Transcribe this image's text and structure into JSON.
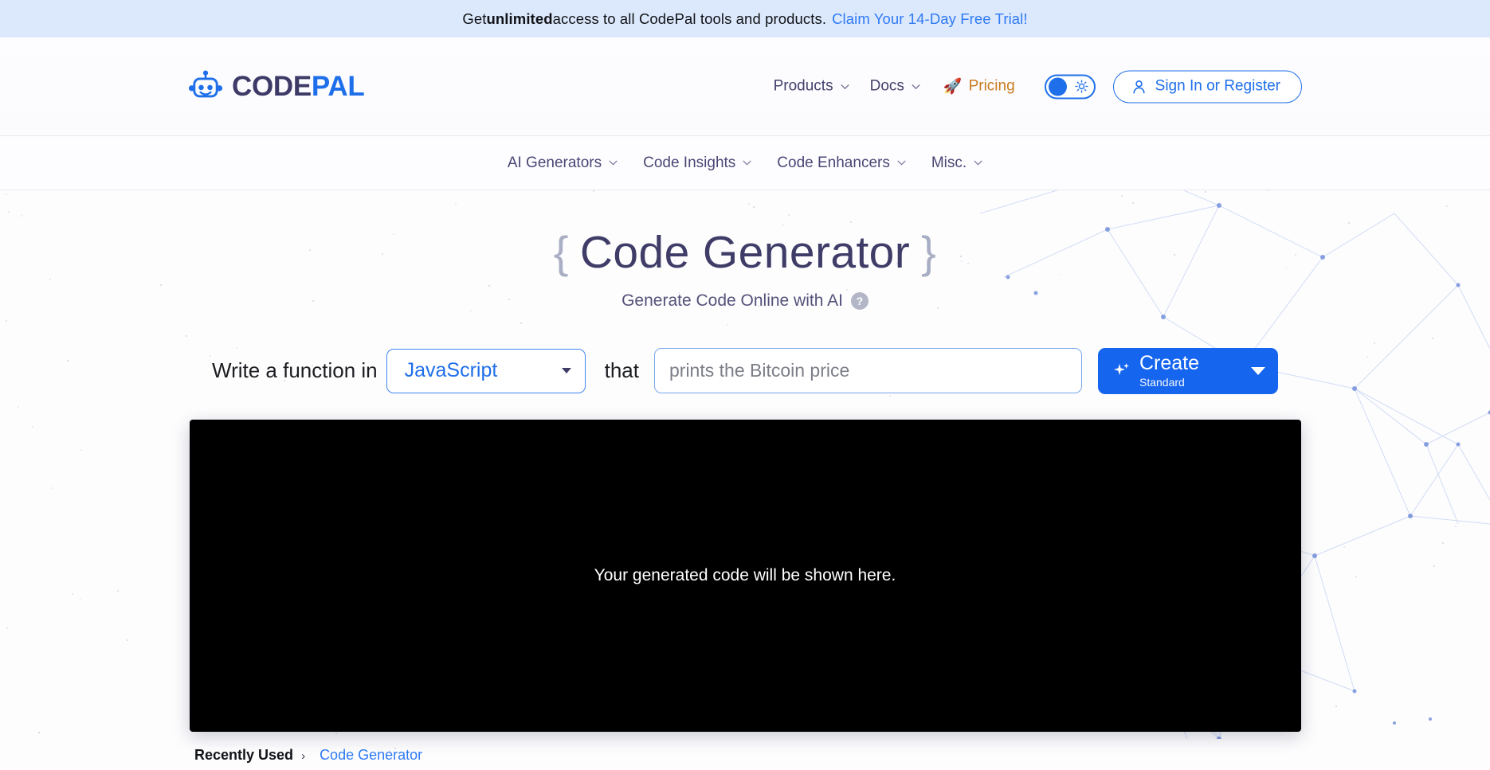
{
  "banner": {
    "text_before": "Get ",
    "bold": "unlimited",
    "text_after": " access to all CodePal tools and products.",
    "cta": "Claim Your 14-Day Free Trial!",
    "background": "#dce8fb",
    "link_color": "#2f7af5"
  },
  "header": {
    "logo": {
      "icon": "robot-icon",
      "text_primary": "CODE",
      "text_secondary": "PAL",
      "primary_color": "#3d3a68",
      "secondary_color": "#1f6fea"
    },
    "nav": [
      {
        "label": "Products",
        "icon": "chevron-down-icon"
      },
      {
        "label": "Docs",
        "icon": "chevron-down-icon"
      }
    ],
    "pricing": {
      "label": "Pricing",
      "icon": "rocket-icon",
      "glyph": "🚀",
      "color": "#c97a1f"
    },
    "theme_toggle": {
      "state": "light",
      "icon": "sun-icon",
      "accent": "#1f6fea"
    },
    "signin": {
      "label": "Sign In or Register",
      "icon": "user-icon",
      "color": "#1f6fea"
    }
  },
  "subnav": {
    "items": [
      {
        "label": "AI Generators",
        "icon": "chevron-down-icon"
      },
      {
        "label": "Code Insights",
        "icon": "chevron-down-icon"
      },
      {
        "label": "Code Enhancers",
        "icon": "chevron-down-icon"
      },
      {
        "label": "Misc.",
        "icon": "chevron-down-icon"
      }
    ]
  },
  "hero": {
    "brace_open": "{",
    "title": "Code Generator",
    "brace_close": "}",
    "subtitle": "Generate Code Online with AI",
    "help_icon_label": "?"
  },
  "form": {
    "label_prefix": "Write a function in",
    "language_selected": "JavaScript",
    "label_middle": "that",
    "prompt_value": "",
    "prompt_placeholder": "prints the Bitcoin price",
    "create": {
      "icon": "sparkle-icon",
      "label": "Create",
      "sublabel": "Standard",
      "caret_icon": "caret-down-icon",
      "color": "#1565ef"
    }
  },
  "output": {
    "placeholder": "Your generated code will be shown here.",
    "background": "#000000"
  },
  "recently_used": {
    "label": "Recently Used",
    "separator": "›",
    "items": [
      {
        "label": "Code Generator"
      }
    ]
  }
}
